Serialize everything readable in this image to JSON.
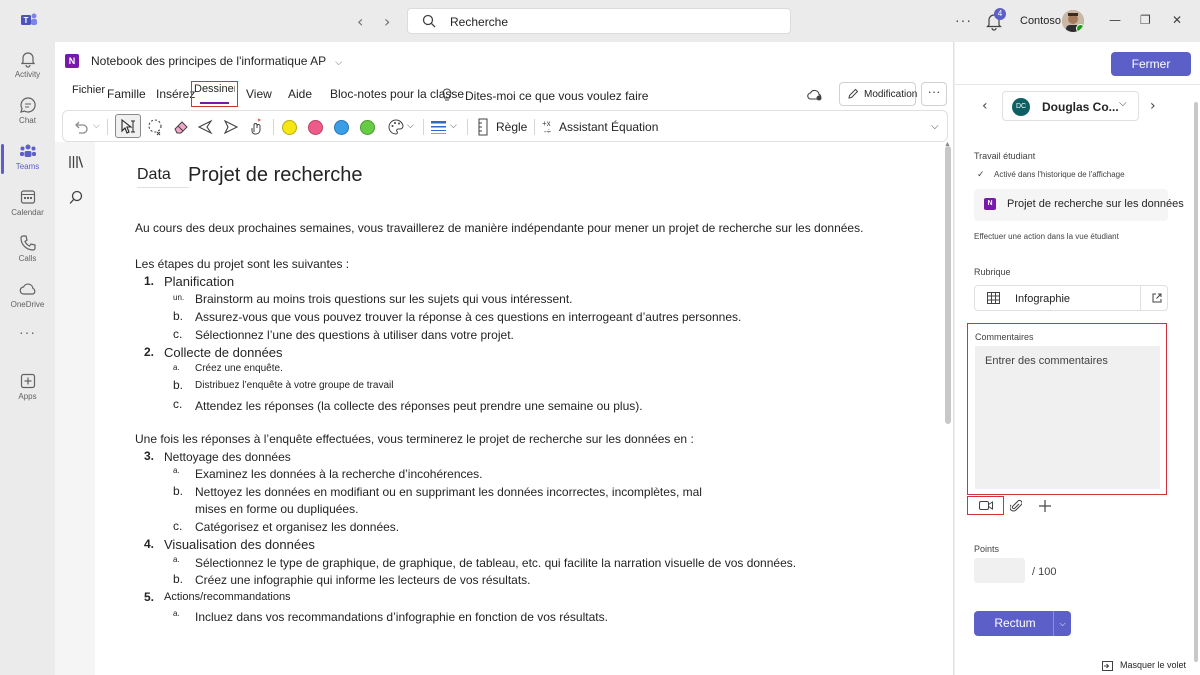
{
  "titlebar": {
    "search_placeholder": "Recherche",
    "notification_count": "4",
    "org_name": "Contoso"
  },
  "rail": [
    {
      "label": "Activity",
      "icon": "bell-icon"
    },
    {
      "label": "Chat",
      "icon": "chat-icon"
    },
    {
      "label": "Teams",
      "icon": "teams-icon",
      "active": true
    },
    {
      "label": "Calendar",
      "icon": "calendar-icon"
    },
    {
      "label": "Calls",
      "icon": "phone-icon"
    },
    {
      "label": "OneDrive",
      "icon": "cloud-icon"
    },
    {
      "label": "Apps",
      "icon": "add-apps-icon"
    }
  ],
  "onenote": {
    "notebook_title": "Notebook des principes de l'informatique AP",
    "tabs": [
      "Fichier",
      "Famille",
      "Insérez",
      "Dessiner",
      "View",
      "Aide",
      "Bloc-notes pour la classe"
    ],
    "active_tab": "Dessiner",
    "tell_me": "Dites-moi ce que vous voulez faire",
    "modification": "Modification",
    "ribbon": {
      "ruler": "Règle",
      "equation": "Assistant Équation",
      "pen_colors": [
        "#f5e614",
        "#ee5b8a",
        "#3b9de8",
        "#66cc44"
      ]
    }
  },
  "page": {
    "tag": "Data",
    "title": "Projet de recherche",
    "intro": "Au cours des deux prochaines semaines, vous travaillerez de manière indépendante pour mener un projet de recherche sur les données.",
    "steps_intro": "Les étapes du projet sont les suivantes :",
    "steps": [
      {
        "num": "1.",
        "title": "Planification",
        "subs": [
          {
            "mark": "un.",
            "text": "Brainstorm au moins trois questions sur les sujets qui vous intéressent."
          },
          {
            "mark": "b.",
            "text": "Assurez-vous que vous pouvez trouver la réponse à ces questions en interrogeant d’autres personnes."
          },
          {
            "mark": "c.",
            "text": "Sélectionnez l’une des questions à utiliser dans votre projet."
          }
        ]
      },
      {
        "num": "2.",
        "title": "Collecte de données",
        "subs": [
          {
            "mark": "a.",
            "text": "Créez une enquête."
          },
          {
            "mark": "b.",
            "text": "Distribuez l’enquête à votre groupe de travail"
          },
          {
            "mark": "c.",
            "text": "Attendez les réponses (la collecte des réponses peut prendre une semaine ou plus)."
          }
        ]
      }
    ],
    "after_intro": "Une fois les réponses à l’enquête effectuées, vous terminerez le projet de recherche sur les données en :",
    "steps2": [
      {
        "num": "3.",
        "title": "Nettoyage des données",
        "subs": [
          {
            "mark": "a.",
            "text": "Examinez les données à la recherche d’incohérences."
          },
          {
            "mark": "b.",
            "text": "Nettoyez les données en modifiant ou en supprimant les données incorrectes, incomplètes, mal"
          },
          {
            "mark": "",
            "text": "mises en forme ou dupliquées."
          },
          {
            "mark": "c.",
            "text": "Catégorisez et organisez les données."
          }
        ]
      },
      {
        "num": "4.",
        "title": "Visualisation des données",
        "subs": [
          {
            "mark": "a.",
            "text": "Sélectionnez le type de graphique, de graphique, de tableau, etc. qui facilite la narration visuelle de vos données."
          },
          {
            "mark": "b.",
            "text": "Créez une infographie qui informe les lecteurs de vos résultats."
          }
        ]
      },
      {
        "num": "5.",
        "title": "Actions/recommandations",
        "subs": [
          {
            "mark": "a.",
            "text": "Incluez dans vos recommandations d’infographie en fonction de vos résultats."
          }
        ]
      }
    ]
  },
  "panel": {
    "close": "Fermer",
    "student_initials": "DC",
    "student_name": "Douglas Co...",
    "student_work_label": "Travail étudiant",
    "history_enabled": "Activé dans l'historique de l'affichage",
    "work_title": "Projet de recherche sur les données",
    "action_hint": "Effectuer une action dans la vue étudiant",
    "rubric_label": "Rubrique",
    "rubric_name": "Infographie",
    "comments_label": "Commentaires",
    "comments_placeholder": "Entrer des commentaires",
    "points_label": "Points",
    "points_max": "/ 100",
    "return_button": "Rectum",
    "hide_pane": "Masquer le volet"
  }
}
